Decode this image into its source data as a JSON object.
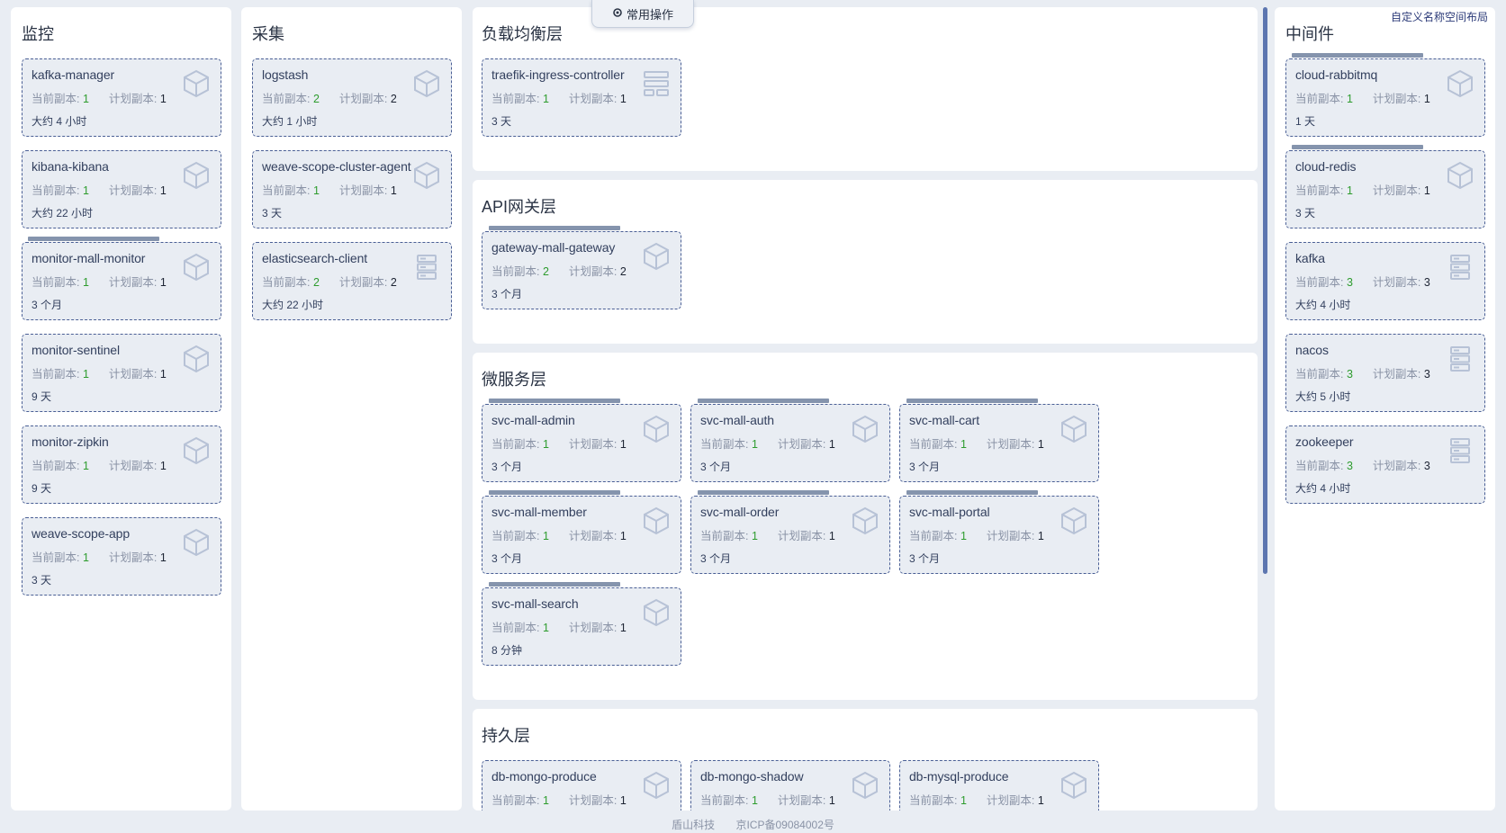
{
  "quick_actions": {
    "label": "常用操作",
    "icon": "gear-icon"
  },
  "custom_layout_link": "自定义名称空间布局",
  "labels": {
    "current": "当前副本:",
    "planned": "计划副本:"
  },
  "columns": {
    "monitor": {
      "title": "监控",
      "cards": [
        {
          "name": "kafka-manager",
          "current": "1",
          "planned": "1",
          "age": "大约 4 小时",
          "icon": "cube-icon"
        },
        {
          "name": "kibana-kibana",
          "current": "1",
          "planned": "1",
          "age": "大约 22 小时",
          "icon": "cube-icon"
        },
        {
          "name": "monitor-mall-monitor",
          "current": "1",
          "planned": "1",
          "age": "3 个月",
          "icon": "cube-icon"
        },
        {
          "name": "monitor-sentinel",
          "current": "1",
          "planned": "1",
          "age": "9 天",
          "icon": "cube-icon"
        },
        {
          "name": "monitor-zipkin",
          "current": "1",
          "planned": "1",
          "age": "9 天",
          "icon": "cube-icon"
        },
        {
          "name": "weave-scope-app",
          "current": "1",
          "planned": "1",
          "age": "3 天",
          "icon": "cube-icon"
        }
      ]
    },
    "collect": {
      "title": "采集",
      "cards": [
        {
          "name": "logstash",
          "current": "2",
          "planned": "2",
          "age": "大约 1 小时",
          "icon": "cube-icon"
        },
        {
          "name": "weave-scope-cluster-agent",
          "current": "1",
          "planned": "1",
          "age": "3 天",
          "icon": "cube-icon"
        },
        {
          "name": "elasticsearch-client",
          "current": "2",
          "planned": "2",
          "age": "大约 22 小时",
          "icon": "server-icon"
        }
      ]
    },
    "middleware": {
      "title": "中间件",
      "cards": [
        {
          "name": "cloud-rabbitmq",
          "current": "1",
          "planned": "1",
          "age": "1 天",
          "icon": "cube-icon"
        },
        {
          "name": "cloud-redis",
          "current": "1",
          "planned": "1",
          "age": "3 天",
          "icon": "cube-icon"
        },
        {
          "name": "kafka",
          "current": "3",
          "planned": "3",
          "age": "大约 4 小时",
          "icon": "server-icon"
        },
        {
          "name": "nacos",
          "current": "3",
          "planned": "3",
          "age": "大约 5 小时",
          "icon": "server-icon"
        },
        {
          "name": "zookeeper",
          "current": "3",
          "planned": "3",
          "age": "大约 4 小时",
          "icon": "server-icon"
        }
      ]
    }
  },
  "sections": {
    "lb": {
      "title": "负载均衡层",
      "cards": [
        {
          "name": "traefik-ingress-controller",
          "current": "1",
          "planned": "1",
          "age": "3 天",
          "icon": "daemonset-icon"
        }
      ]
    },
    "gateway": {
      "title": "API网关层",
      "cards": [
        {
          "name": "gateway-mall-gateway",
          "current": "2",
          "planned": "2",
          "age": "3 个月",
          "icon": "cube-icon"
        }
      ]
    },
    "micro": {
      "title": "微服务层",
      "cards": [
        {
          "name": "svc-mall-admin",
          "current": "1",
          "planned": "1",
          "age": "3 个月",
          "icon": "cube-icon"
        },
        {
          "name": "svc-mall-auth",
          "current": "1",
          "planned": "1",
          "age": "3 个月",
          "icon": "cube-icon"
        },
        {
          "name": "svc-mall-cart",
          "current": "1",
          "planned": "1",
          "age": "3 个月",
          "icon": "cube-icon"
        },
        {
          "name": "svc-mall-member",
          "current": "1",
          "planned": "1",
          "age": "3 个月",
          "icon": "cube-icon"
        },
        {
          "name": "svc-mall-order",
          "current": "1",
          "planned": "1",
          "age": "3 个月",
          "icon": "cube-icon"
        },
        {
          "name": "svc-mall-portal",
          "current": "1",
          "planned": "1",
          "age": "3 个月",
          "icon": "cube-icon"
        },
        {
          "name": "svc-mall-search",
          "current": "1",
          "planned": "1",
          "age": "8 分钟",
          "icon": "cube-icon"
        }
      ]
    },
    "persist": {
      "title": "持久层",
      "cards": [
        {
          "name": "db-mongo-produce",
          "current": "1",
          "planned": "1",
          "age": "",
          "icon": "cube-icon"
        },
        {
          "name": "db-mongo-shadow",
          "current": "1",
          "planned": "1",
          "age": "",
          "icon": "cube-icon"
        },
        {
          "name": "db-mysql-produce",
          "current": "1",
          "planned": "1",
          "age": "",
          "icon": "cube-icon"
        }
      ]
    }
  },
  "footer": {
    "company": "盾山科技",
    "icp": "京ICP备09084002号"
  }
}
